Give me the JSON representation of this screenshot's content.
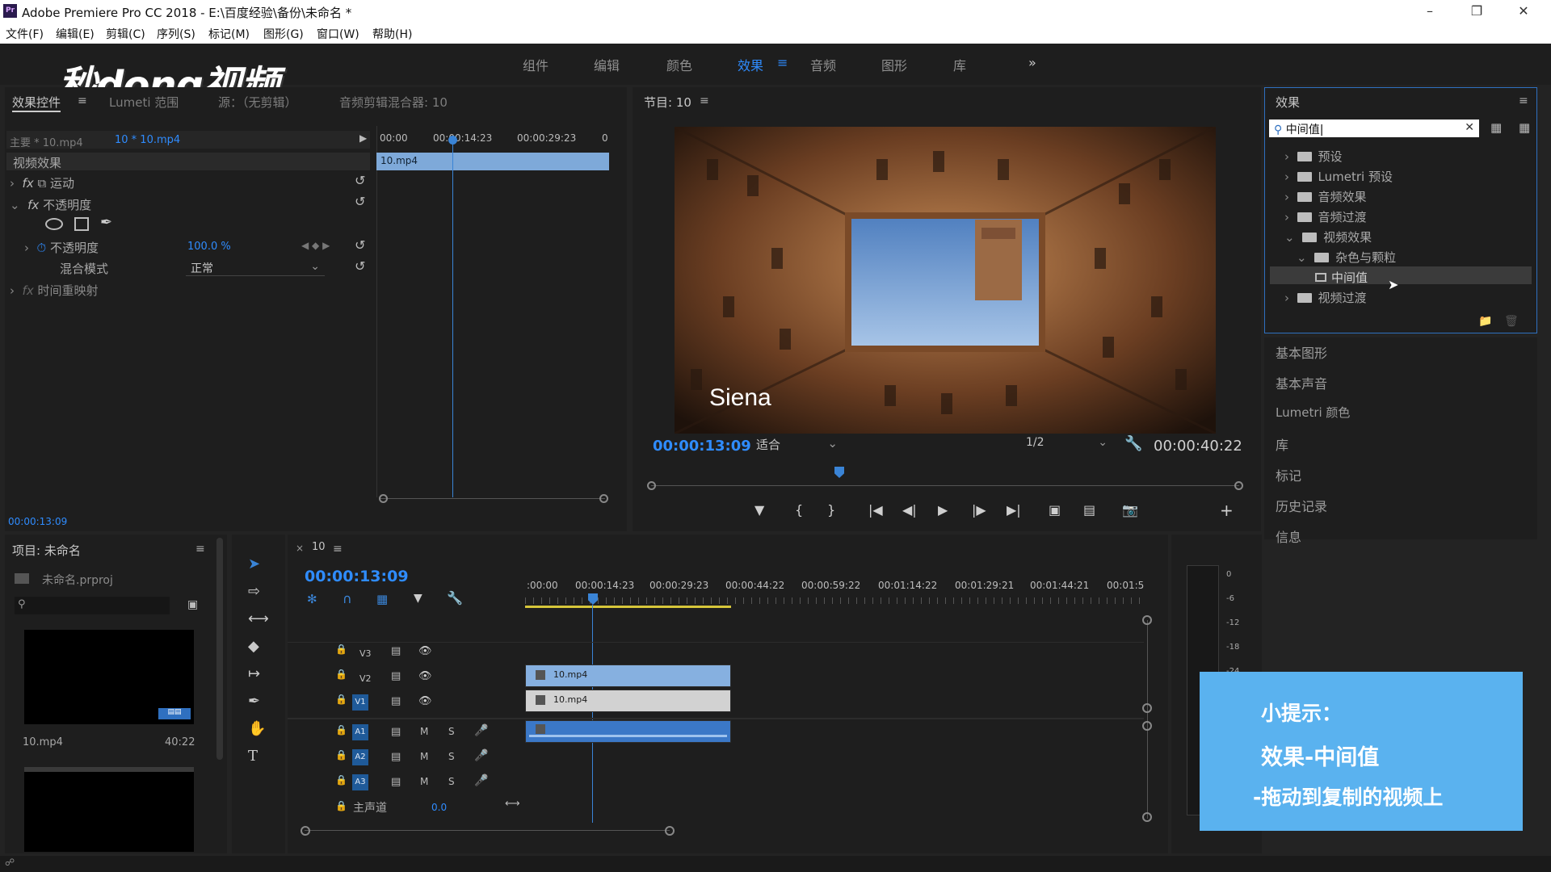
{
  "window": {
    "title": "Adobe Premiere Pro CC 2018 - E:\\百度经验\\备份\\未命名 *",
    "app_icon": "Pr"
  },
  "menu": [
    "文件(F)",
    "编辑(E)",
    "剪辑(C)",
    "序列(S)",
    "标记(M)",
    "图形(G)",
    "窗口(W)",
    "帮助(H)"
  ],
  "workspaces": {
    "items": [
      "组件",
      "编辑",
      "颜色",
      "效果",
      "音频",
      "图形",
      "库"
    ],
    "active": "效果",
    "more": "»"
  },
  "watermark": "秒dong视频",
  "effect_controls": {
    "tabs": [
      "效果控件",
      "Lumeti 范围",
      "源：（无剪辑）",
      "音频剪辑混合器: 10"
    ],
    "master_clip": "主要 * 10.mp4",
    "seq_clip": "10 * 10.mp4",
    "ruler": [
      "00:00",
      "00:00:14:23",
      "00:00:29:23",
      "0"
    ],
    "clip_bar": "10.mp4",
    "section": "视频效果",
    "motion": "运动",
    "opacity": "不透明度",
    "opacity_param": "不透明度",
    "opacity_value": "100.0 %",
    "blend_label": "混合模式",
    "blend_value": "正常",
    "time_remap": "时间重映射",
    "timecode": "00:00:13:09"
  },
  "program": {
    "title": "节目: 10",
    "overlay_text": "Siena",
    "timecode": "00:00:13:09",
    "fit": "适合",
    "resolution": "1/2",
    "duration": "00:00:40:22"
  },
  "effects": {
    "title": "效果",
    "search_value": "中间值",
    "tree": [
      {
        "label": "预设",
        "expanded": false
      },
      {
        "label": "Lumetri 预设",
        "expanded": false
      },
      {
        "label": "音频效果",
        "expanded": false
      },
      {
        "label": "音频过渡",
        "expanded": false
      },
      {
        "label": "视频效果",
        "expanded": true
      },
      {
        "label": "杂色与颗粒",
        "expanded": true
      },
      {
        "label": "中间值",
        "selected": true
      },
      {
        "label": "视频过渡",
        "expanded": false
      }
    ]
  },
  "right_panels": [
    "基本图形",
    "基本声音",
    "Lumetri 颜色",
    "库",
    "标记",
    "历史记录",
    "信息"
  ],
  "project": {
    "title": "项目: 未命名",
    "file": "未命名.prproj",
    "clip_name": "10.mp4",
    "clip_duration": "40:22"
  },
  "timeline": {
    "tab": "10",
    "timecode": "00:00:13:09",
    "ticks": [
      ":00:00",
      "00:00:14:23",
      "00:00:29:23",
      "00:00:44:22",
      "00:00:59:22",
      "00:01:14:22",
      "00:01:29:21",
      "00:01:44:21",
      "00:01:5"
    ],
    "tracks": [
      "V3",
      "V2",
      "V1",
      "A1",
      "A2",
      "A3"
    ],
    "master": "主声道",
    "master_value": "0.0",
    "clip_v2": "10.mp4",
    "clip_v1": "10.mp4",
    "meter_scale": [
      "0",
      "-6",
      "-12",
      "-18",
      "-24"
    ]
  },
  "tip": {
    "line1": "小提示：",
    "line2": "效果-中间值",
    "line3": "-拖动到复制的视频上"
  }
}
